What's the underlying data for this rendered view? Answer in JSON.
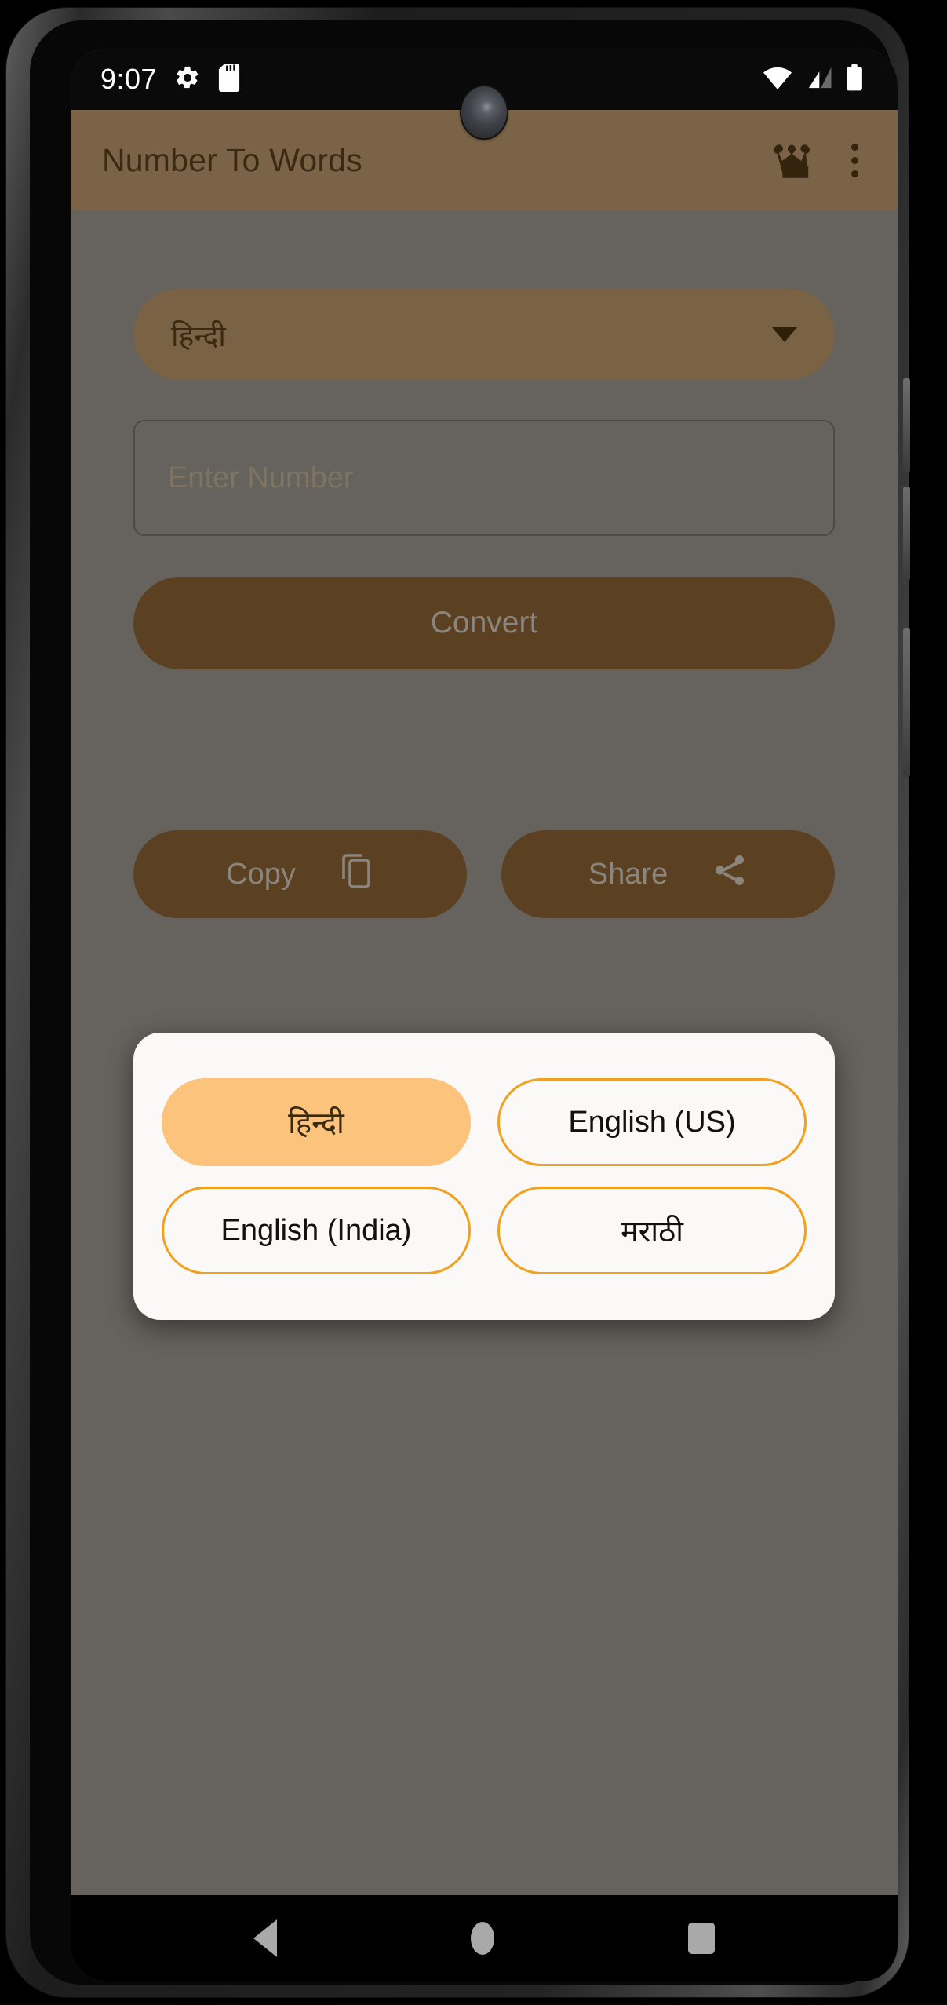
{
  "status_bar": {
    "clock": "9:07",
    "left_icons": [
      "gear-icon",
      "sd-card-icon"
    ],
    "right_icons": [
      "wifi-icon",
      "cellular-signal-icon",
      "battery-icon"
    ]
  },
  "app_bar": {
    "title": "Number To Words",
    "crown_icon": "crown-icon",
    "overflow_icon": "overflow-menu-icon"
  },
  "main": {
    "language_dropdown": {
      "value": "हिन्दी",
      "caret_icon": "chevron-down-icon"
    },
    "number_input": {
      "value": "",
      "placeholder": "Enter Number"
    },
    "convert_button": {
      "label": "Convert"
    },
    "actions": [
      {
        "label": "Copy",
        "icon": "copy-icon"
      },
      {
        "label": "Share",
        "icon": "share-icon"
      }
    ]
  },
  "language_dialog": {
    "options": [
      {
        "label": "हिन्दी",
        "selected": true
      },
      {
        "label": "English (US)",
        "selected": false
      },
      {
        "label": "English (India)",
        "selected": false
      },
      {
        "label": "मराठी",
        "selected": false
      }
    ]
  },
  "nav_bar": {
    "back_label": "Back",
    "home_label": "Home",
    "recents_label": "Recents"
  },
  "colors": {
    "app_bar": "#7B6347",
    "accent_orange": "#F2A01D",
    "accent_selected": "#FBC37C",
    "button_brown": "#5B4122",
    "dropdown_brown": "#7A6245",
    "scrim": "#66625D",
    "dialog_bg": "#FBF9F7"
  }
}
